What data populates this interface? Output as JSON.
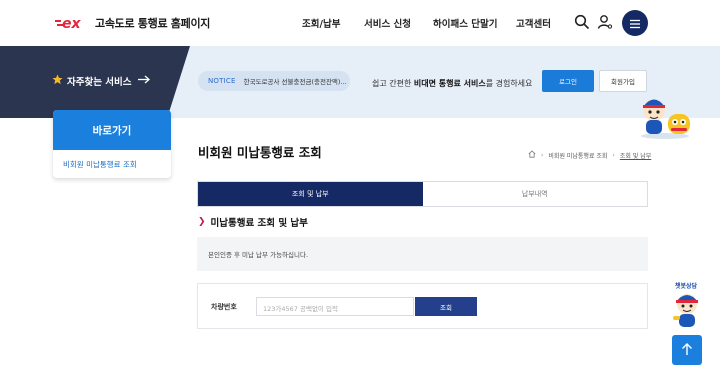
{
  "header": {
    "logo_mark": "ex",
    "site_name": "고속도로 통행료 홈페이지",
    "nav": [
      "조회/납부",
      "서비스 신청",
      "하이패스 단말기",
      "고객센터"
    ]
  },
  "band": {
    "favorites_label": "자주찾는 서비스",
    "notice_tag": "NOTICE",
    "notice_text": "한국도로공사 선불충전금(충전잔액)...",
    "promo_prefix": "쉽고 간편한 ",
    "promo_bold": "비대면 통행료 서비스",
    "promo_suffix": "를 경험하세요",
    "login_label": "로그인",
    "join_label": "회원가입"
  },
  "sidebar": {
    "title": "바로가기",
    "items": [
      "비회원 미납통행료 조회"
    ]
  },
  "main": {
    "page_title": "비회원 미납통행료 조회",
    "breadcrumb": [
      "비회원 미납통행료 조회",
      "조회 및 납부"
    ],
    "tabs": [
      "조회 및 납부",
      "납부내역"
    ],
    "section_title": "미납통행료 조회 및 납부",
    "info_text": "본인인증 후 미납 납부 가능하십니다.",
    "form": {
      "label": "차량번호",
      "placeholder": "123가4567 공백없이 입력",
      "submit_label": "조회"
    }
  },
  "floating": {
    "chat_label": "챗봇상담"
  },
  "colors": {
    "navy": "#152a64",
    "brand_blue": "#1b80dd",
    "brand_red": "#e2263b",
    "band_light": "#e6eef7",
    "band_dark": "#2c3550"
  }
}
